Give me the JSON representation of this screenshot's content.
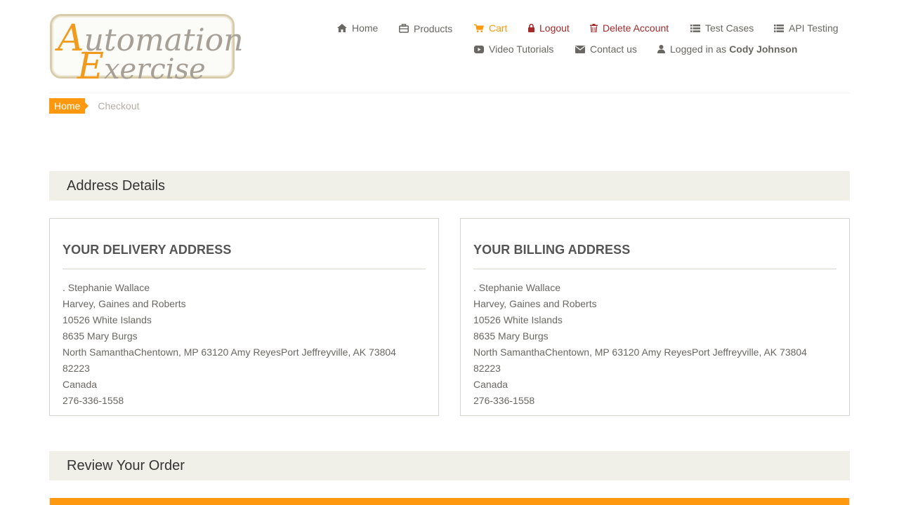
{
  "logo": {
    "line1_cap": "A",
    "line1_rest": "utomation",
    "line2_cap": "E",
    "line2_rest": "xercise"
  },
  "nav": {
    "home": "Home",
    "products": "Products",
    "cart": "Cart",
    "logout": "Logout",
    "delete_account": "Delete Account",
    "test_cases": "Test Cases",
    "api_testing": "API Testing",
    "video_tutorials": "Video Tutorials",
    "contact_us": "Contact us",
    "logged_in_prefix": "Logged in as",
    "logged_in_user": "Cody Johnson"
  },
  "colors": {
    "accent": "#fe980f",
    "danger": "#a52a2a",
    "section_bg": "#f0f0e9",
    "text": "#696763"
  },
  "breadcrumb": {
    "home": "Home",
    "current": "Checkout"
  },
  "address_section": {
    "title": "Address Details"
  },
  "delivery": {
    "title": "YOUR DELIVERY ADDRESS",
    "lines": [
      ". Stephanie Wallace",
      "Harvey, Gaines and Roberts",
      "10526 White Islands",
      "8635 Mary Burgs",
      "North SamanthaChentown, MP 63120 Amy ReyesPort Jeffreyville, AK 73804",
      "82223",
      "Canada",
      "276-336-1558"
    ]
  },
  "billing": {
    "title": "YOUR BILLING ADDRESS",
    "lines": [
      ". Stephanie Wallace",
      "Harvey, Gaines and Roberts",
      "10526 White Islands",
      "8635 Mary Burgs",
      "North SamanthaChentown, MP 63120 Amy ReyesPort Jeffreyville, AK 73804",
      "82223",
      "Canada",
      "276-336-1558"
    ]
  },
  "review_section": {
    "title": "Review Your Order"
  }
}
